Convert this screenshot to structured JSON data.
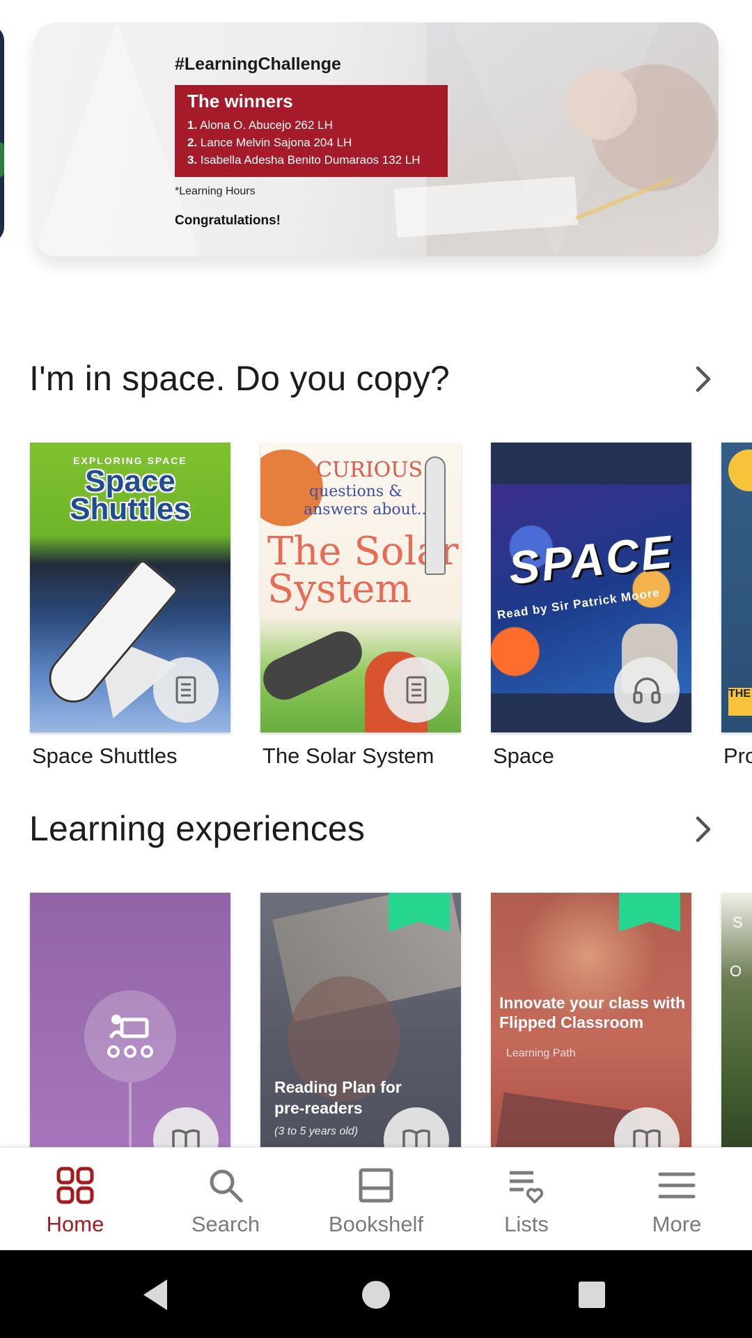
{
  "banner": {
    "hashtag": "#LearningChallenge",
    "box_title": "The winners",
    "winners": [
      {
        "rank": "1.",
        "text": "Alona O. Abucejo 262 LH"
      },
      {
        "rank": "2.",
        "text": "Lance Melvin Sajona 204 LH"
      },
      {
        "rank": "3.",
        "text": "Isabella Adesha Benito Dumaraos 132 LH"
      }
    ],
    "note": "*Learning Hours",
    "congrats": "Congratulations!",
    "box_color": "#a51b2a"
  },
  "sections": [
    {
      "title": "I'm in space. Do you copy?",
      "items": [
        {
          "caption": "Space Shuttles",
          "badge_icon": "document-icon"
        },
        {
          "caption": "The Solar System",
          "badge_icon": "document-icon"
        },
        {
          "caption": "Space",
          "badge_icon": "headphones-icon"
        },
        {
          "caption": "Pro",
          "badge_icon": ""
        }
      ]
    },
    {
      "title": "Learning experiences",
      "items": [
        {
          "caption": "",
          "badge_icon": "open-book-icon"
        },
        {
          "caption": "",
          "badge_icon": "open-book-icon",
          "bookmarked": true
        },
        {
          "caption": "",
          "badge_icon": "open-book-icon",
          "bookmarked": true
        },
        {
          "caption": "",
          "badge_icon": ""
        }
      ]
    }
  ],
  "covers": {
    "space_shuttles": {
      "top": "EXPLORING SPACE",
      "title_1": "Space",
      "title_2": "Shuttles"
    },
    "solar_system": {
      "line_1": "CURIOUS",
      "line_2": "questions &",
      "line_3": "answers about...",
      "title_1": "The Solar",
      "title_2": "System"
    },
    "space": {
      "title": "SPACE",
      "subtitle": "Read by Sir Patrick Moore"
    },
    "peek_book": {
      "text": "THE"
    }
  },
  "learning_cards": {
    "reading_plan": {
      "title": "Reading Plan for pre-readers",
      "subtitle": "(3 to 5 years old)"
    },
    "flipped": {
      "title": "Innovate your class with Flipped Classroom",
      "subtitle": "Learning Path"
    },
    "peek": {
      "letter_1": "S",
      "letter_2": "O"
    }
  },
  "nav": {
    "items": [
      {
        "label": "Home",
        "icon": "grid-icon",
        "active": true
      },
      {
        "label": "Search",
        "icon": "search-icon",
        "active": false
      },
      {
        "label": "Bookshelf",
        "icon": "bookshelf-icon",
        "active": false
      },
      {
        "label": "Lists",
        "icon": "list-heart-icon",
        "active": false
      },
      {
        "label": "More",
        "icon": "menu-icon",
        "active": false
      }
    ],
    "active_color": "#a51b1e",
    "inactive_color": "#7b7b7b"
  },
  "system_nav": {
    "buttons": [
      "back-icon",
      "home-circle-icon",
      "recents-icon"
    ]
  }
}
